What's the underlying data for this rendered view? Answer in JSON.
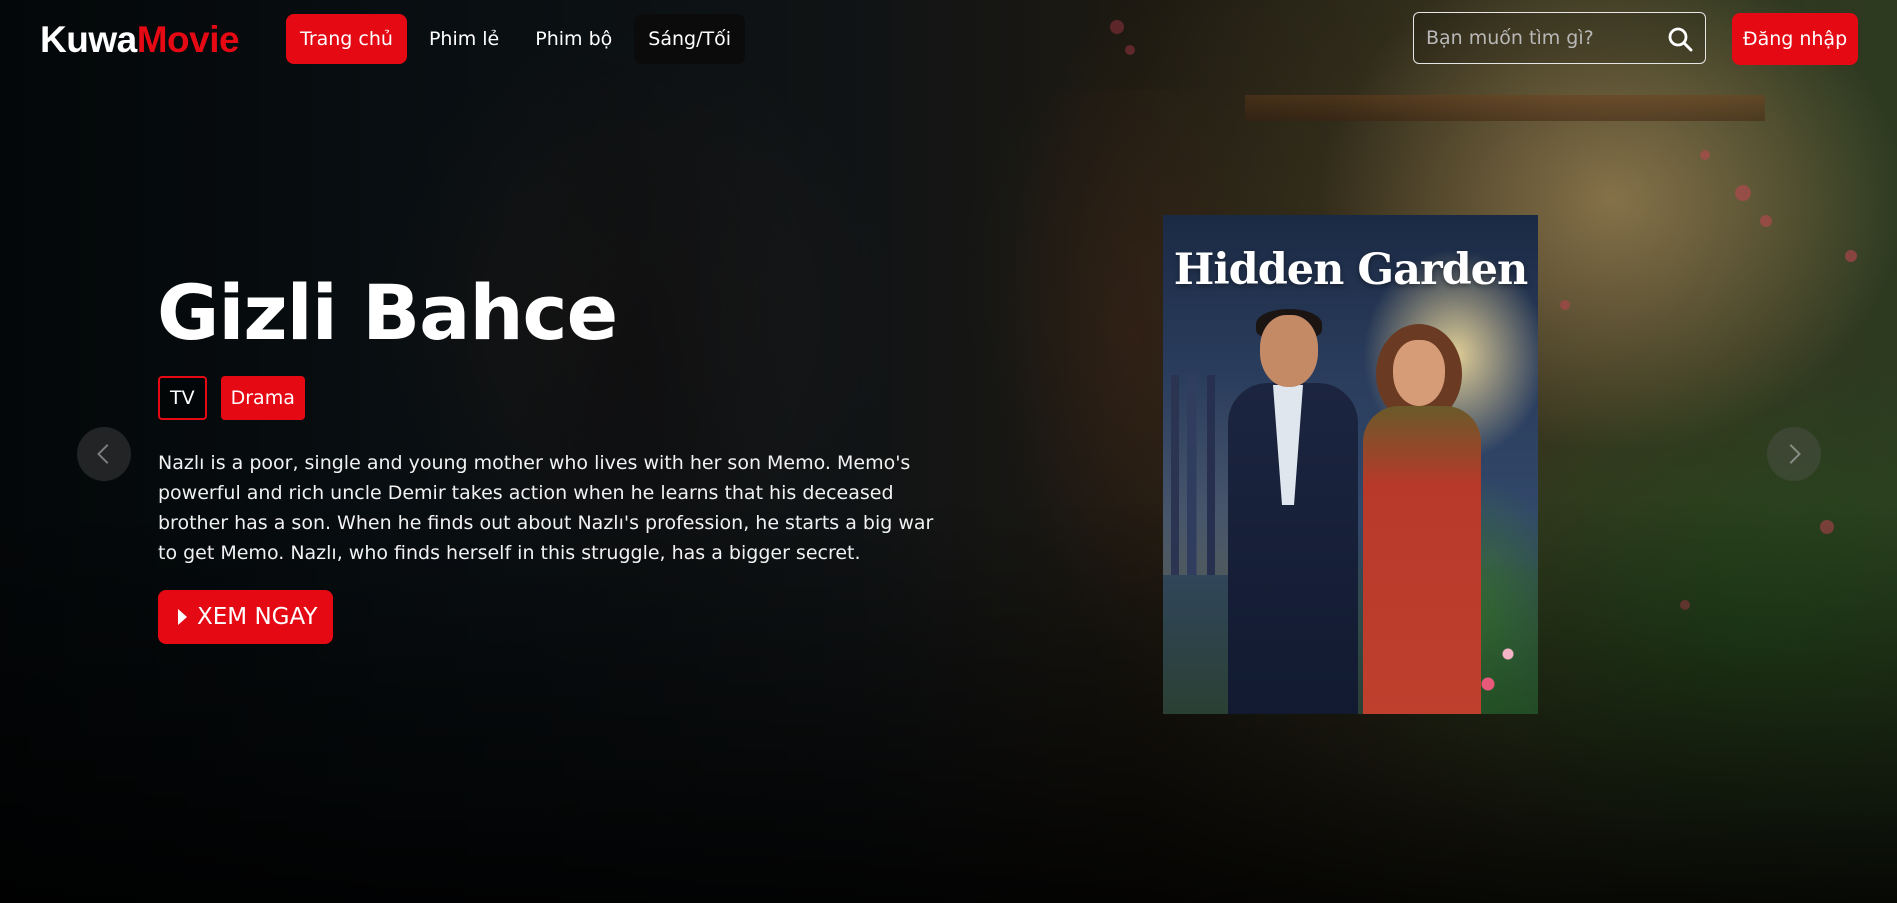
{
  "brand": {
    "part1": "Kuwa",
    "part2": "Movie",
    "accent": "#e50914"
  },
  "nav": {
    "items": [
      {
        "label": "Trang chủ",
        "state": "active"
      },
      {
        "label": "Phim lẻ",
        "state": "normal"
      },
      {
        "label": "Phim bộ",
        "state": "normal"
      },
      {
        "label": "Sáng/Tối",
        "state": "toggle"
      }
    ]
  },
  "search": {
    "placeholder": "Bạn muốn tìm gì?",
    "value": "",
    "icon": "search-icon"
  },
  "auth": {
    "login_label": "Đăng nhập"
  },
  "hero": {
    "title": "Gizli Bahce",
    "tags": [
      "TV",
      "Drama"
    ],
    "description": "Nazlı is a poor, single and young mother who lives with her son Memo. Memo's powerful and rich uncle Demir takes action when he learns that his deceased brother has a son. When he finds out about Nazlı's profession, he starts a big war to get Memo. Nazlı, who finds herself in this struggle, has a bigger secret.",
    "watch_label": "XEM NGAY",
    "poster_title": "Hidden Garden"
  },
  "carousel": {
    "prev_icon": "chevron-left-icon",
    "next_icon": "chevron-right-icon"
  }
}
